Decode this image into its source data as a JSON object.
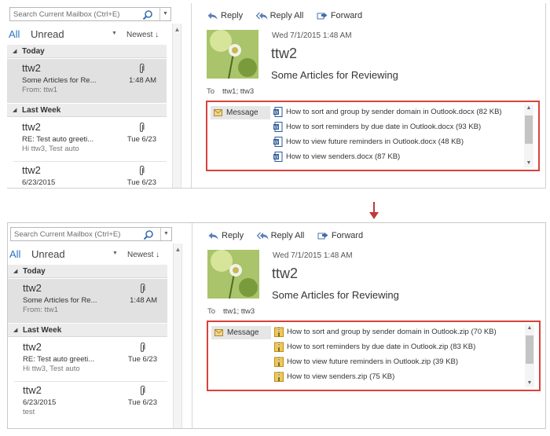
{
  "colors": {
    "accent": "#2a73c2",
    "highlight_box": "#d9423a",
    "selected_row": "#e1e1e1",
    "arrow": "#c0393b"
  },
  "panels": [
    {
      "search": {
        "placeholder": "Search Current Mailbox (Ctrl+E)",
        "icon": "magnifier-icon"
      },
      "filters": {
        "all": "All",
        "unread": "Unread",
        "sort": "Newest"
      },
      "groups": [
        {
          "label": "Today"
        },
        {
          "label": "Last Week"
        }
      ],
      "mails": [
        {
          "sender": "ttw2",
          "subject": "Some Articles for Re...",
          "time": "1:48 AM",
          "preview": "From: ttw1"
        },
        {
          "sender": "ttw2",
          "subject": "RE: Test auto greeti...",
          "time": "Tue 6/23",
          "preview": "Hi ttw3,  Test auto"
        },
        {
          "sender": "ttw2",
          "subject": "6/23/2015",
          "time": "Tue 6/23",
          "preview": ""
        }
      ],
      "toolbar": {
        "reply": "Reply",
        "reply_all": "Reply All",
        "forward": "Forward"
      },
      "message": {
        "date": "Wed 7/1/2015 1:48 AM",
        "from": "ttw2",
        "subject": "Some Articles for Reviewing",
        "to_label": "To",
        "to_value": "ttw1; ttw3",
        "tab_label": "Message",
        "attachments": [
          {
            "name": "How to sort and group by sender domain in Outlook.docx (82 KB)",
            "icon": "word-doc-icon"
          },
          {
            "name": "How to sort reminders by due date in Outlook.docx (93 KB)",
            "icon": "word-doc-icon"
          },
          {
            "name": "How to view future reminders in Outlook.docx (48 KB)",
            "icon": "word-doc-icon"
          },
          {
            "name": "How to view senders.docx (87 KB)",
            "icon": "word-doc-icon"
          }
        ]
      }
    },
    {
      "search": {
        "placeholder": "Search Current Mailbox (Ctrl+E)",
        "icon": "magnifier-icon"
      },
      "filters": {
        "all": "All",
        "unread": "Unread",
        "sort": "Newest"
      },
      "groups": [
        {
          "label": "Today"
        },
        {
          "label": "Last Week"
        }
      ],
      "mails": [
        {
          "sender": "ttw2",
          "subject": "Some Articles for Re...",
          "time": "1:48 AM",
          "preview": "From: ttw1"
        },
        {
          "sender": "ttw2",
          "subject": "RE: Test auto greeti...",
          "time": "Tue 6/23",
          "preview": "Hi ttw3,  Test auto"
        },
        {
          "sender": "ttw2",
          "subject": "6/23/2015",
          "time": "Tue 6/23",
          "preview": "test"
        }
      ],
      "toolbar": {
        "reply": "Reply",
        "reply_all": "Reply All",
        "forward": "Forward"
      },
      "message": {
        "date": "Wed 7/1/2015 1:48 AM",
        "from": "ttw2",
        "subject": "Some Articles for Reviewing",
        "to_label": "To",
        "to_value": "ttw1; ttw3",
        "tab_label": "Message",
        "attachments": [
          {
            "name": "How to sort and group by sender domain in Outlook.zip (70 KB)",
            "icon": "zip-folder-icon"
          },
          {
            "name": "How to sort reminders by due date in Outlook.zip (83 KB)",
            "icon": "zip-folder-icon"
          },
          {
            "name": "How to view future reminders in Outlook.zip (39 KB)",
            "icon": "zip-folder-icon"
          },
          {
            "name": "How to view senders.zip (75 KB)",
            "icon": "zip-folder-icon"
          }
        ]
      }
    }
  ]
}
